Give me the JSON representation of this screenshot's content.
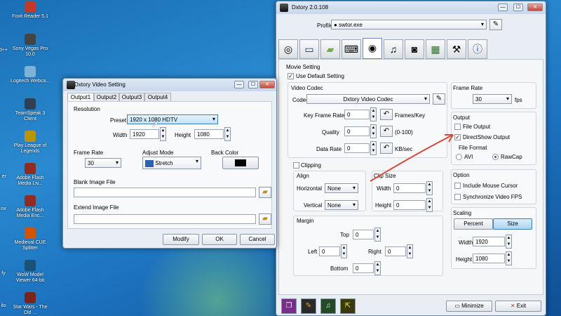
{
  "desktop_icons": [
    {
      "label": "Foxit Reader 5.1",
      "color": "#c0392b"
    },
    {
      "label": "Sony Vegas Pro 10.0",
      "color": "#444"
    },
    {
      "label": "Logitech Webca...",
      "color": "#7fb3d5"
    },
    {
      "label": "TeamSpeak 3 Client",
      "color": "#2e4053"
    },
    {
      "label": "Play League of Legends",
      "color": "#b7950b"
    },
    {
      "label": "Adobe Flash Media Liv...",
      "color": "#922b21"
    },
    {
      "label": "Adobe Flash Media Enc...",
      "color": "#922b21"
    },
    {
      "label": "Medieval CUE Splitter",
      "color": "#d35400"
    },
    {
      "label": "WoW Model Viewer 64-bit",
      "color": "#1a5276"
    },
    {
      "label": "Star Wars - The Old ...",
      "color": "#7b241c"
    }
  ],
  "desktop_edge_text": [
    "d++",
    "edia er",
    "ox",
    "fy",
    "ilo"
  ],
  "main": {
    "title": "Dxtory 2.0.108",
    "profile_label": "Profile",
    "profile_value": "swtor.exe",
    "section_movie": "Movie Setting",
    "use_default": "Use Default Setting",
    "video_codec_group": "Video Codec",
    "codec_label": "Codec",
    "codec_value": "Dxtory Video Codec",
    "keyframe_label": "Key Frame Rate",
    "keyframe_value": "0",
    "keyframe_unit": "Frames/Key",
    "quality_label": "Quality",
    "quality_value": "0",
    "quality_unit": "(0-100)",
    "datarate_label": "Data Rate",
    "datarate_value": "0",
    "datarate_unit": "KB/sec",
    "framerate_group": "Frame Rate",
    "framerate_value": "30",
    "framerate_unit": "fps",
    "output_group": "Output",
    "file_output": "File Output",
    "directshow_output": "DirectShow Output",
    "file_format": "File Format",
    "avi": "AVI",
    "rawcap": "RawCap",
    "clipping": "Clipping",
    "align_group": "Align",
    "horizontal": "Horizontal",
    "horizontal_value": "None",
    "vertical": "Vertical",
    "vertical_value": "None",
    "clipsize_group": "Clip Size",
    "clip_width": "Width",
    "clip_width_value": "0",
    "clip_height": "Height",
    "clip_height_value": "0",
    "margin_group": "Margin",
    "top": "Top",
    "top_value": "0",
    "left": "Left",
    "left_value": "0",
    "right": "Right",
    "right_value": "0",
    "bottom": "Bottom",
    "bottom_value": "0",
    "option_group": "Option",
    "include_cursor": "Include Mouse Cursor",
    "sync_fps": "Synchronize Video FPS",
    "scaling_group": "Scaling",
    "percent_btn": "Percent",
    "size_btn": "Size",
    "scale_width": "Width",
    "scale_width_value": "1920",
    "scale_height": "Height",
    "scale_height_value": "1080",
    "minimize_btn": "Minimize",
    "exit_btn": "Exit"
  },
  "dialog": {
    "title": "Dxtory Video Setting",
    "tabs": [
      "Output1",
      "Output2",
      "Output3",
      "Output4"
    ],
    "resolution_group": "Resolution",
    "preset_label": "Preset",
    "preset_value": "1920 x 1080 HDTV",
    "width_label": "Width",
    "width_value": "1920",
    "height_label": "Height",
    "height_value": "1080",
    "framerate_group": "Frame Rate",
    "framerate_value": "30",
    "adjust_group": "Adjust Mode",
    "adjust_value": "Stretch",
    "backcolor_group": "Back Color",
    "backcolor": "#000000",
    "blank_image": "Blank Image File",
    "extend_image": "Extend Image File",
    "modify_btn": "Modify",
    "ok_btn": "OK",
    "cancel_btn": "Cancel"
  }
}
